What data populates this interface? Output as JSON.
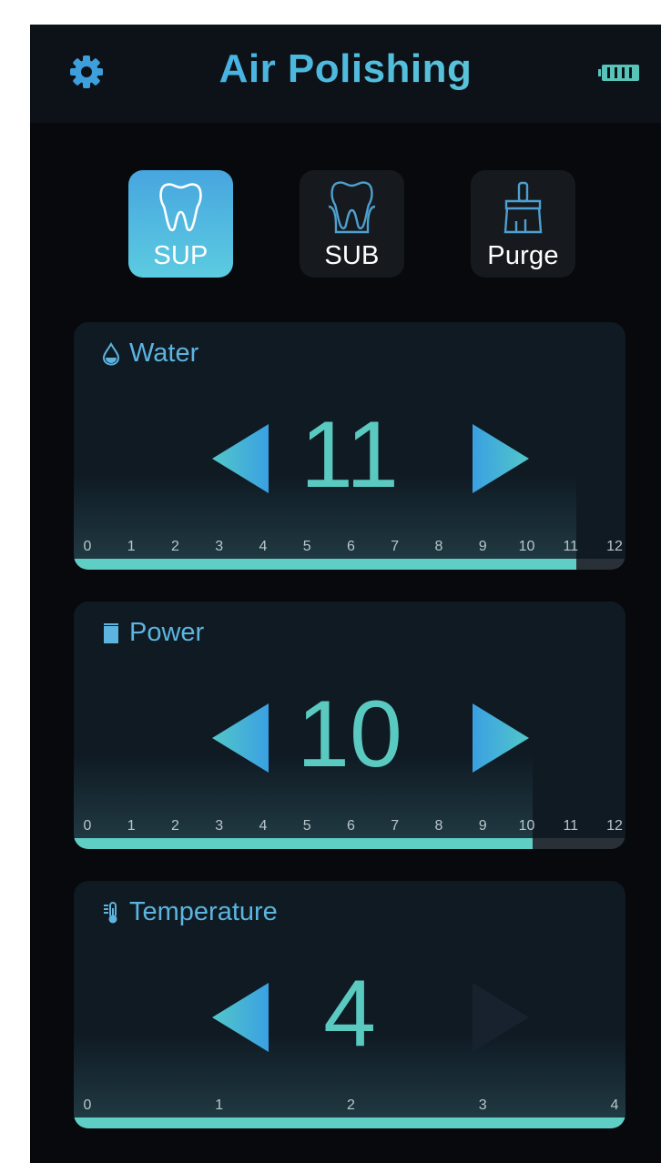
{
  "header": {
    "title": "Air Polishing"
  },
  "modes": [
    {
      "label": "SUP",
      "icon": "tooth-icon",
      "active": true
    },
    {
      "label": "SUB",
      "icon": "tooth-gum-icon",
      "active": false
    },
    {
      "label": "Purge",
      "icon": "brush-icon",
      "active": false
    }
  ],
  "panels": {
    "water": {
      "label": "Water",
      "icon": "water-drop-icon",
      "value": "11",
      "level": 11,
      "max": 12,
      "scale": [
        "0",
        "1",
        "2",
        "3",
        "4",
        "5",
        "6",
        "7",
        "8",
        "9",
        "10",
        "11",
        "12"
      ]
    },
    "power": {
      "label": "Power",
      "icon": "power-block-icon",
      "value": "10",
      "level": 10,
      "max": 12,
      "scale": [
        "0",
        "1",
        "2",
        "3",
        "4",
        "5",
        "6",
        "7",
        "8",
        "9",
        "10",
        "11",
        "12"
      ]
    },
    "temperature": {
      "label": "Temperature",
      "icon": "thermometer-icon",
      "value": "4",
      "level": 4,
      "max": 4,
      "scale": [
        "0",
        "1",
        "2",
        "3",
        "4"
      ],
      "increase_enabled": false
    }
  },
  "colors": {
    "accent": "#4aa8e0",
    "value": "#5ac9c0",
    "bar_fill": "#5fcfc5",
    "bar_track": "#2a3038",
    "background": "#07090c"
  }
}
